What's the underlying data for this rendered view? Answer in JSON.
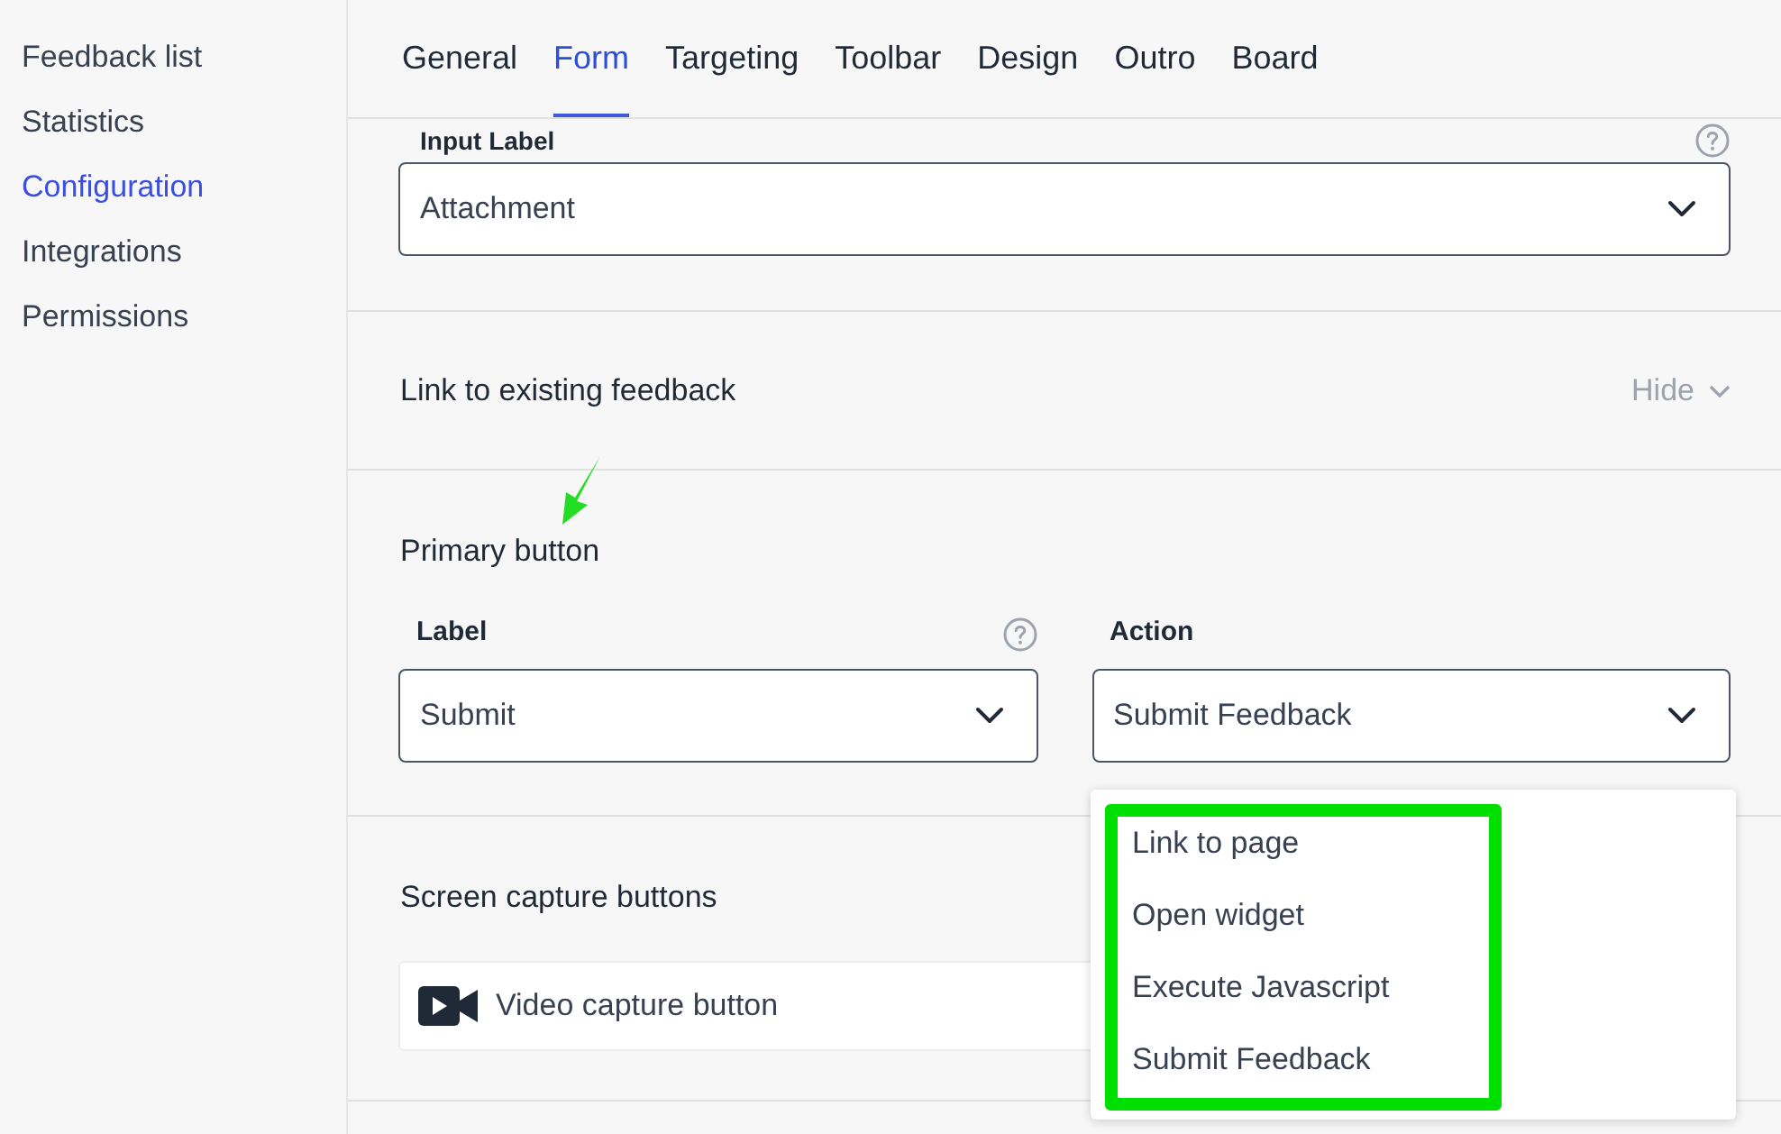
{
  "sidebar": {
    "items": [
      {
        "label": "Feedback list",
        "selected": false
      },
      {
        "label": "Statistics",
        "selected": false
      },
      {
        "label": "Configuration",
        "selected": true
      },
      {
        "label": "Integrations",
        "selected": false
      },
      {
        "label": "Permissions",
        "selected": false
      }
    ]
  },
  "tabs": [
    {
      "label": "General",
      "selected": false
    },
    {
      "label": "Form",
      "selected": true
    },
    {
      "label": "Targeting",
      "selected": false
    },
    {
      "label": "Toolbar",
      "selected": false
    },
    {
      "label": "Design",
      "selected": false
    },
    {
      "label": "Outro",
      "selected": false
    },
    {
      "label": "Board",
      "selected": false
    }
  ],
  "input_label": {
    "label": "Input Label",
    "value": "Attachment"
  },
  "link_section": {
    "title": "Link to existing feedback",
    "toggle": "Hide"
  },
  "primary_button": {
    "title": "Primary button",
    "label_field": {
      "label": "Label",
      "value": "Submit"
    },
    "action_field": {
      "label": "Action",
      "value": "Submit Feedback",
      "expanded": true
    }
  },
  "action_menu": {
    "options": [
      "Link to page",
      "Open widget",
      "Execute Javascript",
      "Submit Feedback"
    ]
  },
  "screen_capture": {
    "title": "Screen capture buttons",
    "items": [
      "Video capture button"
    ]
  }
}
